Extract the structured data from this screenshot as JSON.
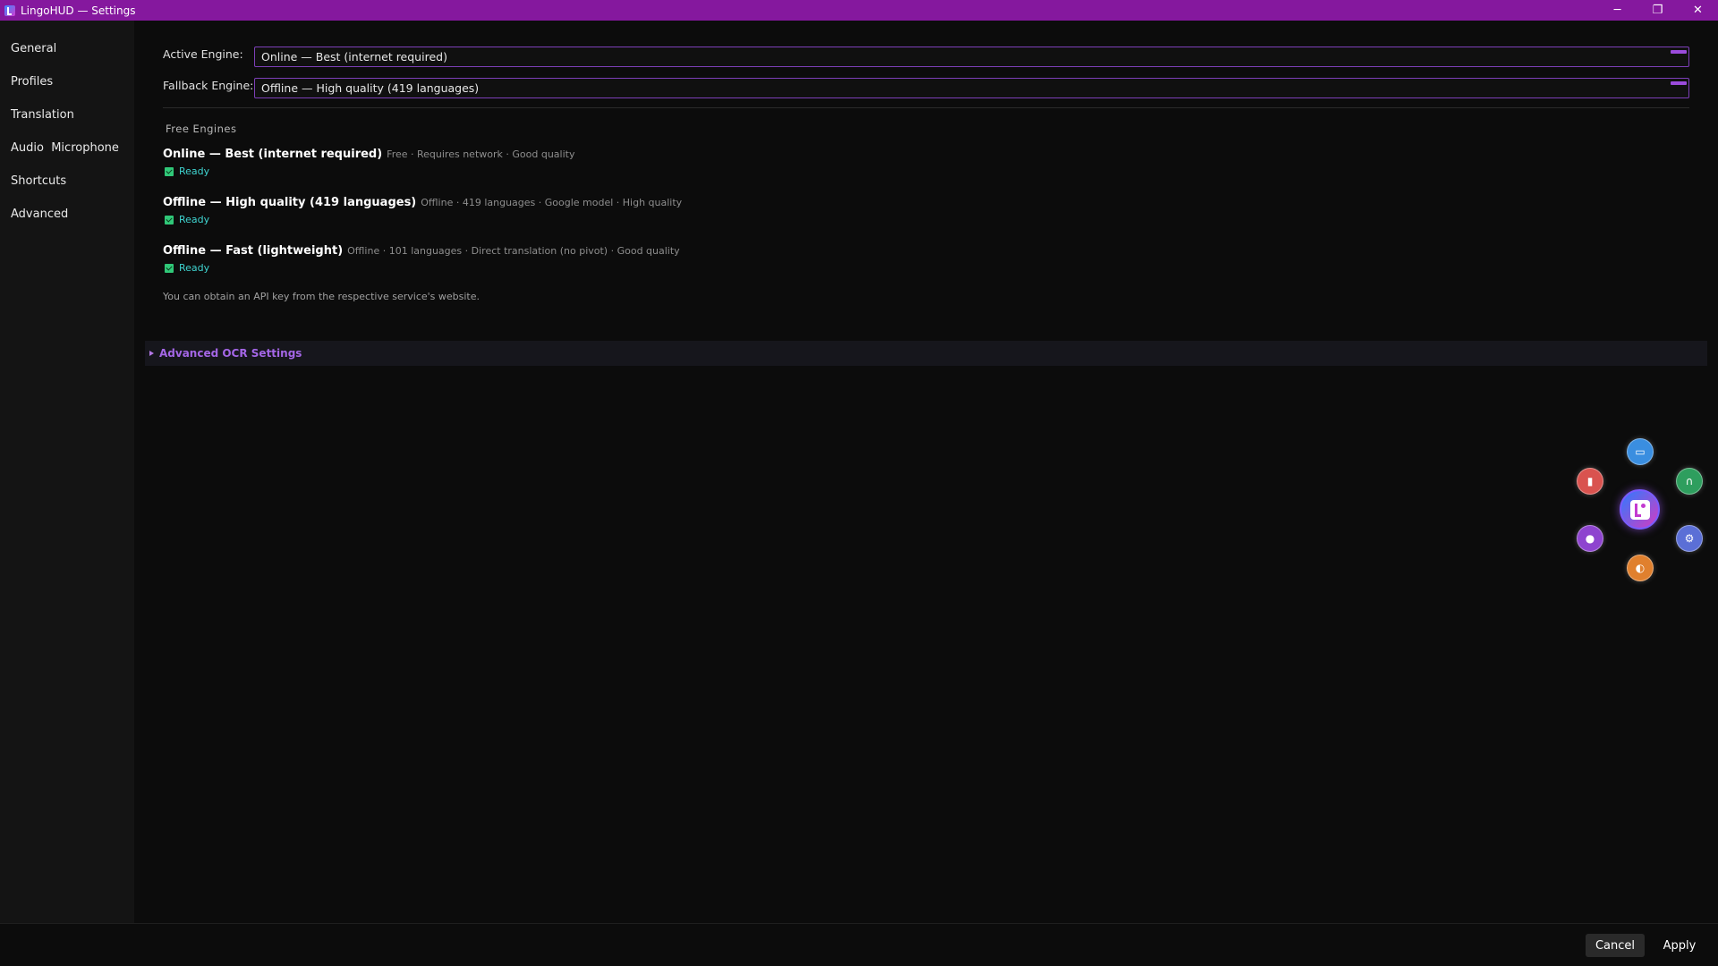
{
  "window": {
    "title": "LingoHUD — Settings",
    "minimize": "─",
    "maximize": "❐",
    "close": "✕"
  },
  "sidebar": {
    "items": [
      {
        "label": "General"
      },
      {
        "label": "Profiles"
      },
      {
        "label": "Translation"
      },
      {
        "label": "Audio  Microphone"
      },
      {
        "label": "Shortcuts"
      },
      {
        "label": "Advanced"
      }
    ]
  },
  "engines": {
    "active_label": "Active Engine:",
    "active_value": "Online — Best (internet required)",
    "fallback_label": "Fallback Engine:",
    "fallback_value": "Offline — High quality (419 languages)"
  },
  "free_engines": {
    "title": "Free Engines",
    "items": [
      {
        "name": "Online — Best (internet required)",
        "desc": "Free · Requires network · Good quality",
        "status": "Ready"
      },
      {
        "name": "Offline — High quality (419 languages)",
        "desc": "Offline · 419 languages · Google model · High quality",
        "status": "Ready"
      },
      {
        "name": "Offline — Fast (lightweight)",
        "desc": "Offline · 101 languages · Direct translation (no pivot) · Good quality",
        "status": "Ready"
      }
    ],
    "hint": "You can obtain an API key from the respective service's website."
  },
  "advanced_ocr": {
    "label": "Advanced OCR Settings"
  },
  "radial_menu": {
    "buttons": [
      {
        "icon": "image-icon",
        "color": "#3a8ee0"
      },
      {
        "icon": "clipboard-icon",
        "color": "#d9534f"
      },
      {
        "icon": "headphones-icon",
        "color": "#2e9e5e"
      },
      {
        "icon": "record-icon",
        "color": "#8e44cf"
      },
      {
        "icon": "gear-icon",
        "color": "#5b6fd6"
      },
      {
        "icon": "moon-icon",
        "color": "#e0802e"
      }
    ]
  },
  "footer": {
    "cancel_label": "Cancel",
    "apply_label": "Apply"
  },
  "colors": {
    "titlebar": "#85189e",
    "accent": "#a466e6",
    "ready": "#3fd4d0"
  }
}
